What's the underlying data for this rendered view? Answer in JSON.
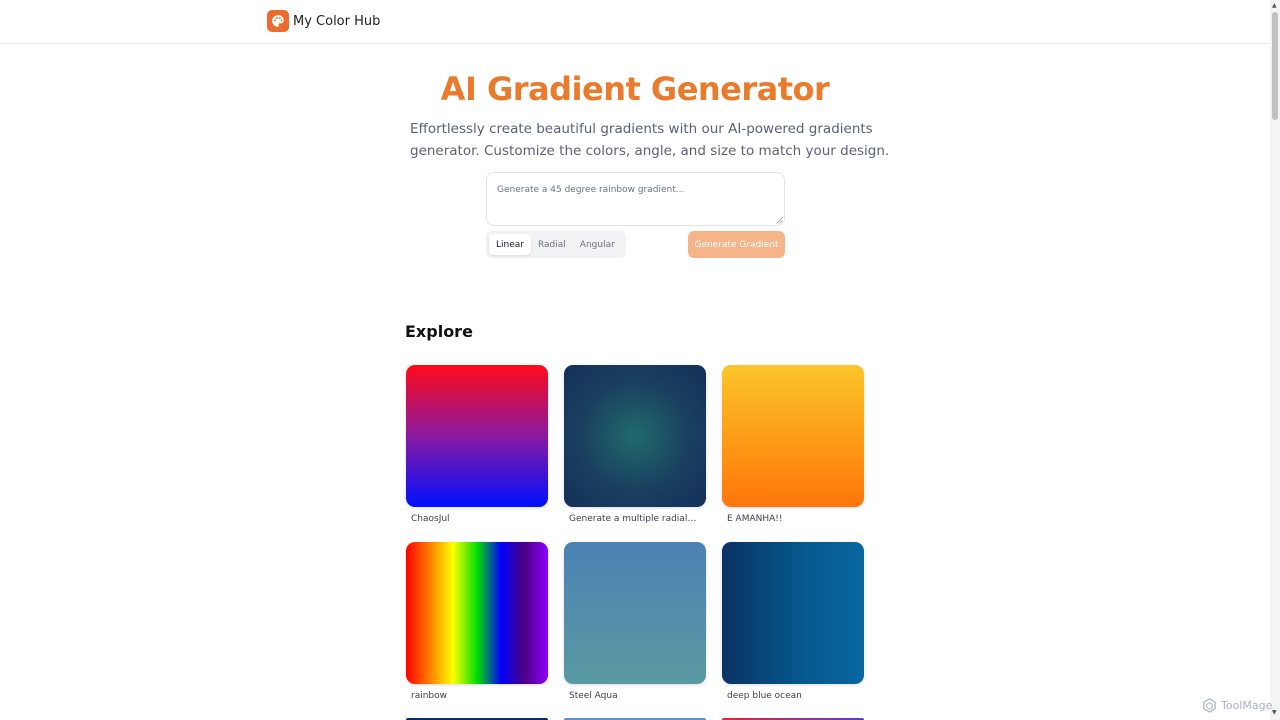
{
  "header": {
    "brand_name": "My Color Hub",
    "logo_icon": "palette-icon",
    "accent": "#ec6b2d"
  },
  "hero": {
    "title": "AI Gradient Generator",
    "subtitle_line1": "Effortlessly create beautiful gradients with our AI-powered gradients",
    "subtitle_line2": "generator. Customize the colors, angle, and size to match your design.",
    "title_color": "#ea7b2c"
  },
  "prompt": {
    "placeholder": "Generate a 45 degree rainbow gradient...",
    "value": ""
  },
  "gradient_types": [
    {
      "label": "Linear",
      "active": true
    },
    {
      "label": "Radial",
      "active": false
    },
    {
      "label": "Angular",
      "active": false
    }
  ],
  "generate_button": {
    "label": "Generate Gradient",
    "color": "#f5b48a"
  },
  "explore": {
    "title": "Explore",
    "cards": [
      {
        "label": "ChaosJul",
        "gradient": "linear-gradient(180deg, #ff0a1a 0%, #8a1aa0 50%, #0010ff 100%)"
      },
      {
        "label": "Generate a multiple radial gradient...",
        "gradient": "radial-gradient(circle at 50% 50%, #206a6e 0%, #1a3f5f 55%, #13305a 100%)"
      },
      {
        "label": "É AMANHÃ!!",
        "gradient": "linear-gradient(180deg, #fbc62a 0%, #fd9d17 50%, #ff760a 100%)"
      },
      {
        "label": "rainbow",
        "gradient": "linear-gradient(90deg, #ff0000 0%, #ff8000 17%, #ffff00 33%, #00e000 50%, #0000ff 67%, #4b0082 83%, #8f00ff 100%)"
      },
      {
        "label": "Steel Aqua",
        "gradient": "linear-gradient(180deg, #4a82b4 0%, #5a9aa2 100%)"
      },
      {
        "label": "deep blue ocean",
        "gradient": "linear-gradient(90deg, #0a3364 0%, #055a8f 60%, #0a67a0 100%)"
      }
    ]
  },
  "watermark": {
    "text": "ToolMage"
  }
}
